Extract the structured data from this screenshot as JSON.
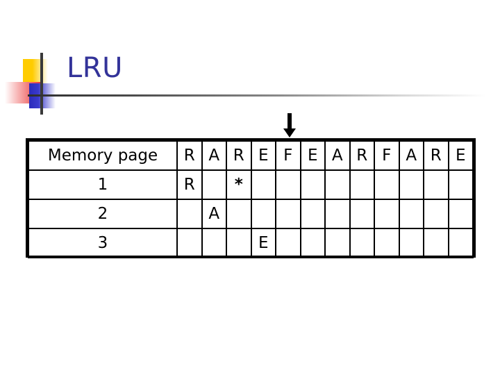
{
  "slide": {
    "title": "LRU",
    "title_color": "#333399",
    "decoration": {
      "square_yellow_color": "#FFCC00",
      "square_red_color": "#EE3333",
      "square_blue_color": "#2B2BBB",
      "rule_color": "#2e2e2e"
    }
  },
  "pointer": {
    "icon": "down-arrow-icon",
    "color": "#000000",
    "points_to_column_index": 5
  },
  "table": {
    "row_header_label": "Memory page",
    "reference_string": [
      "R",
      "A",
      "R",
      "E",
      "F",
      "E",
      "A",
      "R",
      "F",
      "A",
      "R",
      "E"
    ],
    "page_labels": [
      "1",
      "2",
      "3"
    ],
    "fill_color": "#C77FDB",
    "hit_marker": "*",
    "hit_marker_color": "#993333",
    "rows": [
      [
        "R",
        "",
        "*",
        "",
        "",
        "",
        "",
        "",
        "",
        "",
        "",
        ""
      ],
      [
        "",
        "A",
        "",
        "",
        "",
        "",
        "",
        "",
        "",
        "",
        "",
        ""
      ],
      [
        "",
        "",
        "",
        "E",
        "",
        "",
        "",
        "",
        "",
        "",
        "",
        ""
      ]
    ]
  }
}
